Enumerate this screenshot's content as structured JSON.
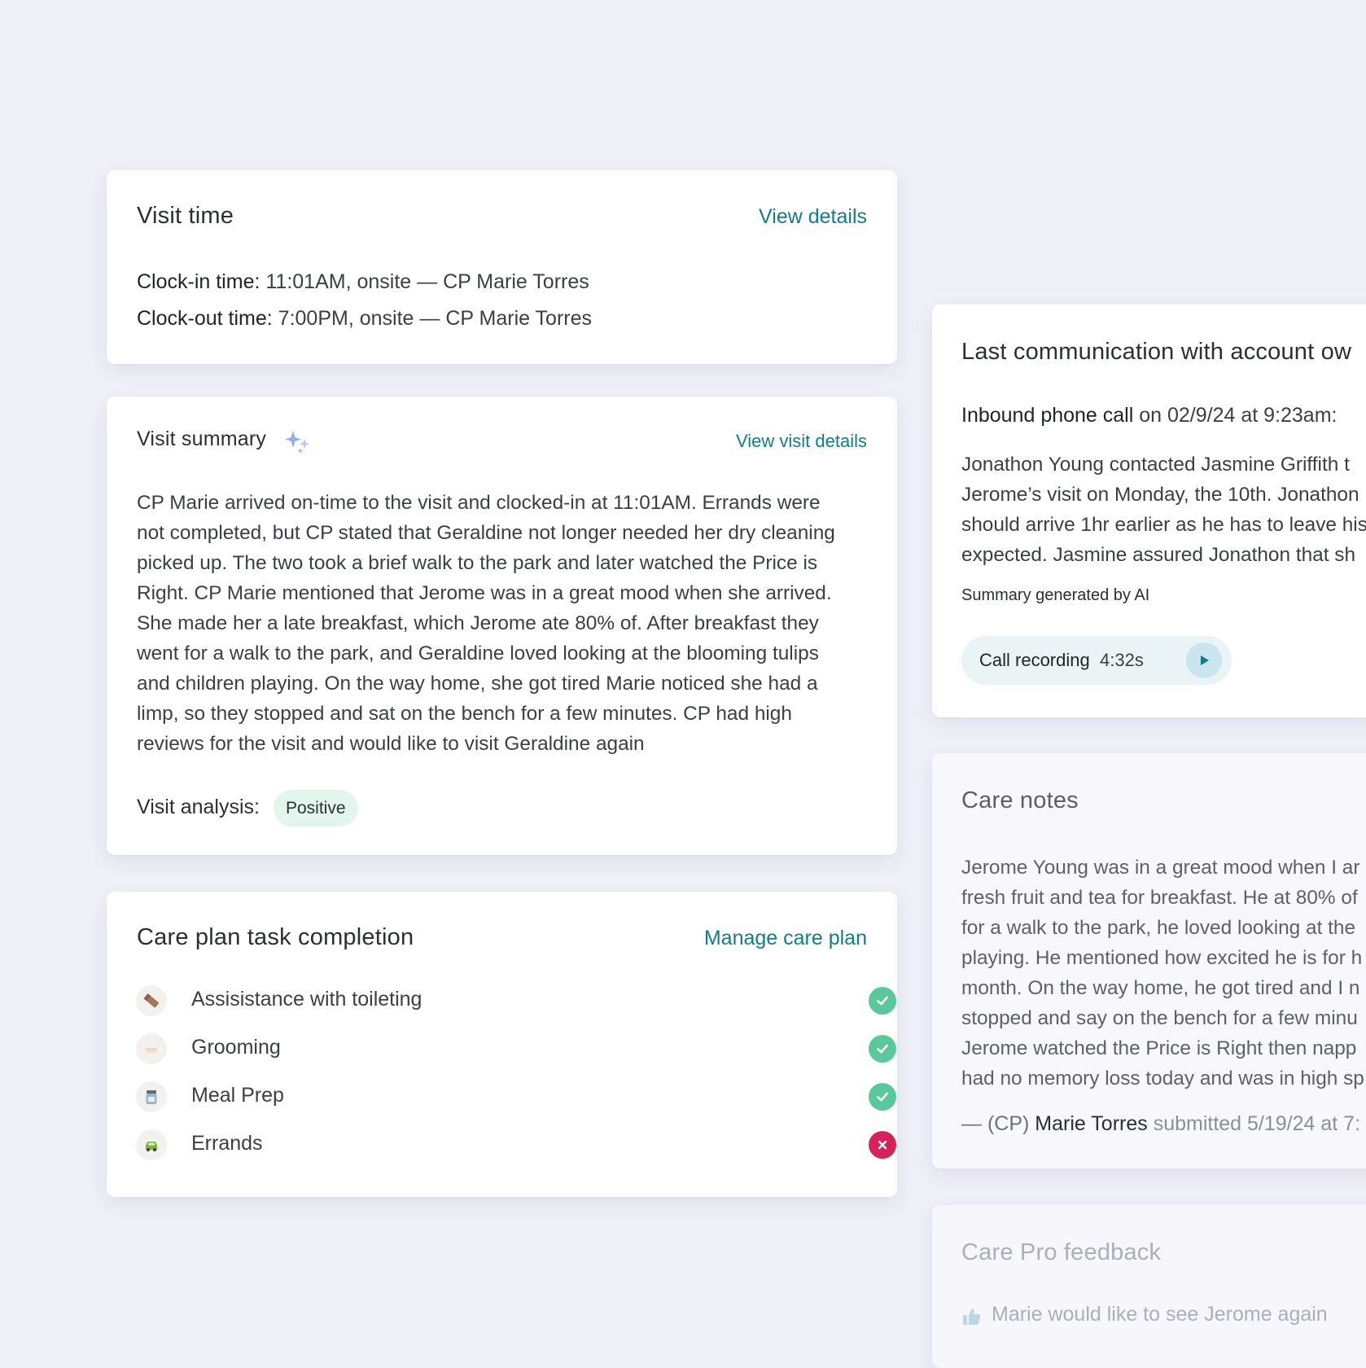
{
  "visit_time": {
    "title": "Visit time",
    "link": "View details",
    "clock_in_label": "Clock-in time:",
    "clock_in_value": " 11:01AM, onsite — CP Marie Torres",
    "clock_out_label": "Clock-out time:",
    "clock_out_value": " 7:00PM, onsite — CP Marie Torres"
  },
  "visit_summary": {
    "title": "Visit summary",
    "link": "View visit details",
    "paragraph_lines": [
      "CP Marie arrived on-time to the visit and clocked-in at 11:01AM. Errands were",
      "not completed, but CP stated that Geraldine not longer needed her dry cleaning",
      "picked up. The two took a brief walk to the park and later watched the Price is",
      "Right. CP Marie mentioned that Jerome was in a great mood when she arrived.",
      "She made her a late breakfast, which Jerome ate 80% of. After breakfast they",
      "went for a walk to the park, and Geraldine loved looking at the blooming tulips",
      "and children playing. On the way home, she got tired Marie noticed she had a",
      "limp, so they stopped and sat on the bench for a few minutes. CP had high",
      "reviews for the visit and would like to visit Geraldine again"
    ],
    "analysis_label": "Visit analysis:",
    "analysis_value": "Positive"
  },
  "care_plan": {
    "title": "Care plan task completion",
    "link": "Manage care plan",
    "tasks": [
      {
        "label": "Assisistance with toileting",
        "icon": "toilet-paper-icon",
        "status": "completed"
      },
      {
        "label": "Grooming",
        "icon": "comb-icon",
        "status": "completed"
      },
      {
        "label": "Meal Prep",
        "icon": "jar-icon",
        "status": "completed"
      },
      {
        "label": "Errands",
        "icon": "car-icon",
        "status": "not-completed"
      }
    ]
  },
  "last_comm": {
    "title": "Last communication with account ow",
    "call_type": "Inbound phone call",
    "call_when": " on 02/9/24 at 9:23am:",
    "paragraph_lines": [
      "Jonathon Young contacted Jasmine Griffith t",
      "Jerome’s visit on Monday, the 10th. Jonathon",
      "should arrive 1hr earlier as he has to leave his",
      "expected. Jasmine assured Jonathon that sh"
    ],
    "ai_note": "Summary generated by AI",
    "recording_label": "Call recording",
    "recording_duration": "4:32s"
  },
  "care_notes": {
    "title": "Care notes",
    "paragraph_lines": [
      "Jerome Young was in a great mood when I ar",
      "fresh fruit and tea for breakfast. He at 80% of",
      "for a walk to the park, he loved looking at the",
      "playing. He mentioned how excited he is for h",
      "month. On the way home, he got tired and I n",
      "stopped and say on the bench for a few minu",
      "Jerome watched the Price is Right then napp",
      "had no memory loss today and was in high sp"
    ],
    "sig_prefix": "— (CP) ",
    "sig_name": "Marie Torres",
    "sig_suffix": " submitted 5/19/24 at 7:"
  },
  "feedback": {
    "title": "Care Pro feedback",
    "item": "Marie would like to see Jerome again"
  },
  "colors": {
    "background": "#efeff8",
    "link": "#0f7e8a",
    "success": "#59c89a",
    "error": "#d8215a",
    "badge_positive": "#e3f6ee"
  }
}
